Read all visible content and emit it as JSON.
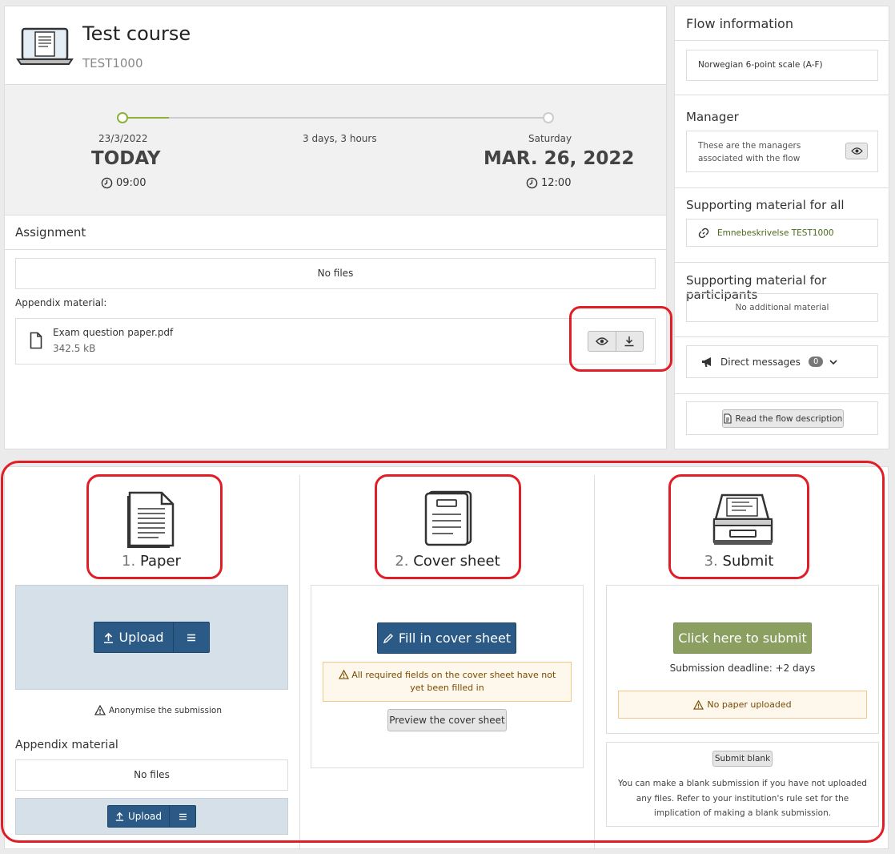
{
  "course": {
    "title": "Test course",
    "code": "TEST1000",
    "icon": "laptop-icon"
  },
  "timeline": {
    "start": {
      "date": "23/3/2022",
      "label": "TODAY",
      "time": "09:00"
    },
    "duration": "3 days, 3 hours",
    "end": {
      "day": "Saturday",
      "label": "MAR. 26, 2022",
      "time": "12:00"
    },
    "progress_percent": 11,
    "accent": "#8db03a"
  },
  "assignment": {
    "title": "Assignment",
    "no_files": "No files",
    "appendix_label": "Appendix material:",
    "file": {
      "name": "Exam question paper.pdf",
      "size": "342.5 kB"
    }
  },
  "sidebar": {
    "flow_info_title": "Flow information",
    "grading_scale": "Norwegian 6-point scale (A-F)",
    "manager_title": "Manager",
    "manager_text": "These are the managers associated with the flow",
    "support_all_title": "Supporting material for all",
    "support_all_link": "Emnebeskrivelse TEST1000",
    "support_participants_title": "Supporting material for participants",
    "no_additional": "No additional material",
    "direct_messages": "Direct messages",
    "direct_messages_count": "0",
    "read_description": "Read the flow description"
  },
  "steps": {
    "paper": {
      "num": "1.",
      "title": "Paper",
      "upload": "Upload",
      "anonymise": "Anonymise the submission",
      "appendix_title": "Appendix material",
      "no_files": "No files",
      "upload_small": "Upload"
    },
    "cover": {
      "num": "2.",
      "title": "Cover sheet",
      "fill": "Fill in cover sheet",
      "warning": "All required fields on the cover sheet have not yet been filled in",
      "preview": "Preview the cover sheet"
    },
    "submit": {
      "num": "3.",
      "title": "Submit",
      "button": "Click here to submit",
      "deadline": "Submission deadline: +2 days",
      "warning": "No paper uploaded",
      "blank_button": "Submit blank",
      "blank_text": "You can make a blank submission if you have not uploaded any files. Refer to your institution's rule set for the implication of making a blank submission."
    }
  },
  "colors": {
    "primary": "#2a5a85",
    "submit_green": "#8a9f60",
    "highlight_red": "#e11d26",
    "link_green": "#4a6a1a"
  }
}
